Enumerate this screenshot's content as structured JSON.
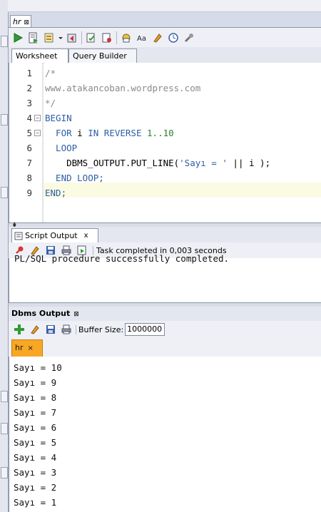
{
  "document_tab": {
    "label": "hr",
    "close": "⊠"
  },
  "toolbar": {
    "icons": [
      "run-statement-icon",
      "run-script-icon",
      "commit-icon",
      "dropdown-arrow-icon",
      "rollback-icon",
      "autotrace-icon",
      "explain-plan-icon",
      "sql-tuning-icon",
      "sql-icon",
      "uppercase-lowercase-icon",
      "clear-icon",
      "history-icon",
      "tools-icon"
    ]
  },
  "editor_tabs": {
    "worksheet": "Worksheet",
    "query_builder": "Query Builder"
  },
  "editor": {
    "line_numbers": [
      "1",
      "2",
      "3",
      "4",
      "5",
      "6",
      "7",
      "8",
      "9"
    ],
    "lines": [
      {
        "parts": [
          {
            "t": "/*",
            "c": "cm"
          }
        ]
      },
      {
        "parts": [
          {
            "t": "www.atakancoban.wordpress.com",
            "c": "cm"
          }
        ]
      },
      {
        "parts": [
          {
            "t": "*/",
            "c": "cm"
          }
        ]
      },
      {
        "parts": [
          {
            "t": "BEGIN",
            "c": "kw"
          }
        ]
      },
      {
        "parts": [
          {
            "t": "  FOR ",
            "c": "kw"
          },
          {
            "t": "i ",
            "c": ""
          },
          {
            "t": "IN REVERSE ",
            "c": "kw"
          },
          {
            "t": "1..10",
            "c": "num"
          }
        ]
      },
      {
        "parts": [
          {
            "t": "  LOOP",
            "c": "kw"
          }
        ]
      },
      {
        "parts": [
          {
            "t": "    DBMS_OUTPUT.PUT_LINE(",
            "c": ""
          },
          {
            "t": "'Sayı = '",
            "c": "str"
          },
          {
            "t": " || i );",
            "c": ""
          }
        ]
      },
      {
        "parts": [
          {
            "t": "  END LOOP;",
            "c": "kw"
          }
        ]
      },
      {
        "parts": [
          {
            "t": "END;",
            "c": "kw"
          }
        ]
      }
    ]
  },
  "script_output": {
    "tab_label": "Script Output",
    "tab_close": "x",
    "status": "Task completed in 0,003 seconds",
    "text": "PL/SQL procedure successfully completed."
  },
  "dbms_output": {
    "title": "Dbms Output",
    "close": "⊠",
    "buffer_label": "Buffer Size:",
    "buffer_value": "1000000",
    "connection_tab": "hr",
    "connection_close": "×",
    "lines": [
      "Sayı = 10",
      "Sayı = 9",
      "Sayı = 8",
      "Sayı = 7",
      "Sayı = 6",
      "Sayı = 5",
      "Sayı = 4",
      "Sayı = 3",
      "Sayı = 2",
      "Sayı = 1"
    ]
  }
}
